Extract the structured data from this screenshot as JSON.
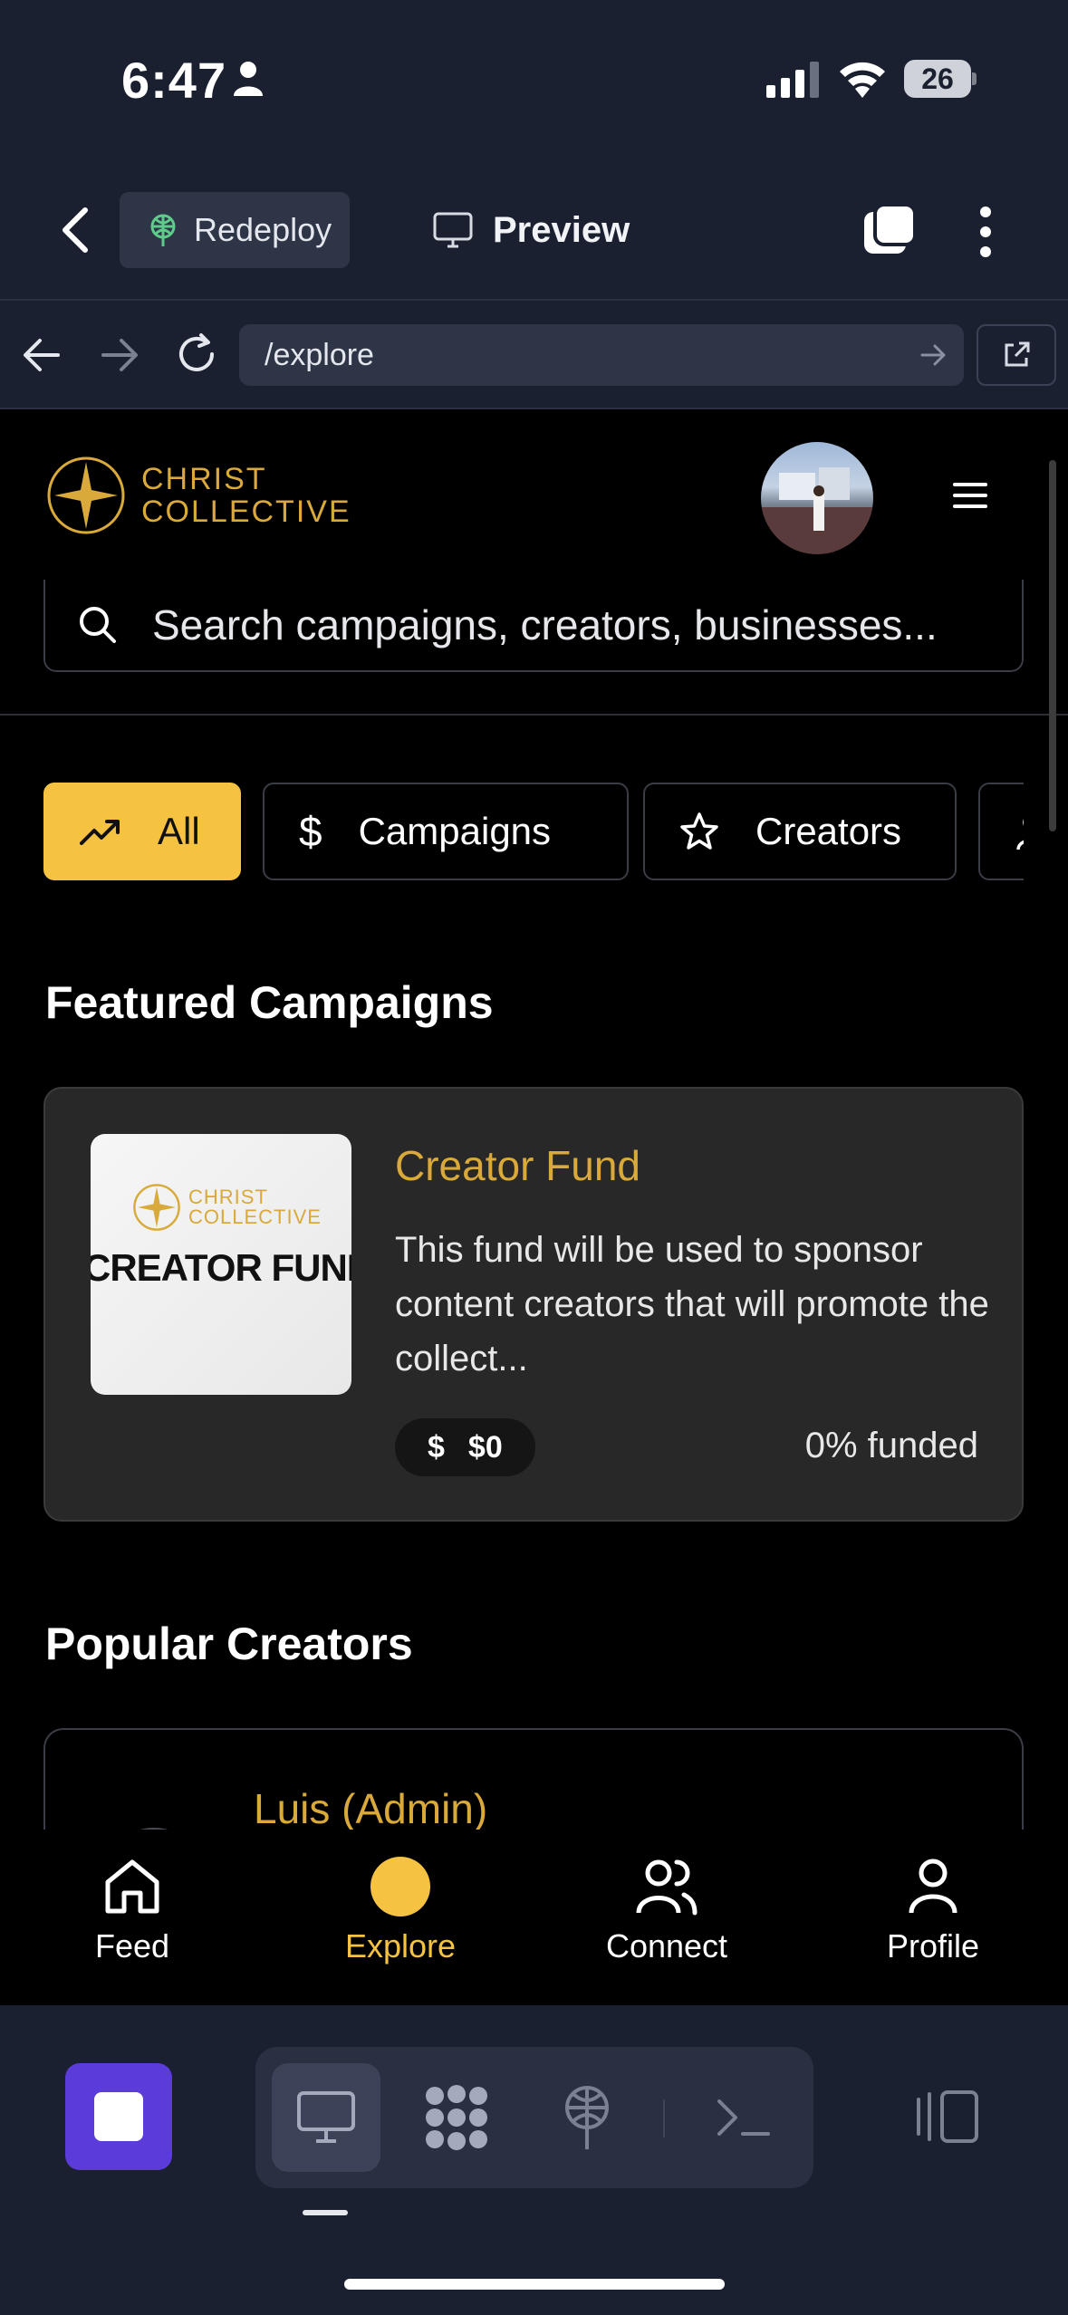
{
  "status_bar": {
    "time": "6:47",
    "battery": "26"
  },
  "replit_bar": {
    "redeploy_label": "Redeploy",
    "preview_label": "Preview",
    "url": "/explore"
  },
  "site": {
    "brand_line1": "CHRIST",
    "brand_line2": "COLLECTIVE",
    "search_placeholder": "Search campaigns, creators, businesses...",
    "filters": [
      {
        "label": "All",
        "icon": "trending-up-icon",
        "active": true
      },
      {
        "label": "Campaigns",
        "icon": "dollar-icon",
        "active": false
      },
      {
        "label": "Creators",
        "icon": "star-icon",
        "active": false
      }
    ],
    "featured_title": "Featured Campaigns",
    "campaign": {
      "thumb_brand_line1": "CHRIST",
      "thumb_brand_line2": "COLLECTIVE",
      "thumb_title": "CREATOR FUND",
      "name": "Creator Fund",
      "description": "This fund will be used to sponsor content creators that will promote the collect...",
      "amount": "$0",
      "funded": "0% funded"
    },
    "popular_title": "Popular Creators",
    "creator": {
      "name": "Luis (Admin)"
    },
    "tabs": [
      {
        "label": "Feed",
        "icon": "home-icon",
        "active": false
      },
      {
        "label": "Explore",
        "icon": "explore-dot-icon",
        "active": true
      },
      {
        "label": "Connect",
        "icon": "users-icon",
        "active": false
      },
      {
        "label": "Profile",
        "icon": "user-icon",
        "active": false
      }
    ]
  },
  "colors": {
    "accent_gold": "#f5c242",
    "brand_gold": "#d9a93a",
    "chrome_bg": "#1b2030",
    "stop_purple": "#5b3cdb"
  }
}
